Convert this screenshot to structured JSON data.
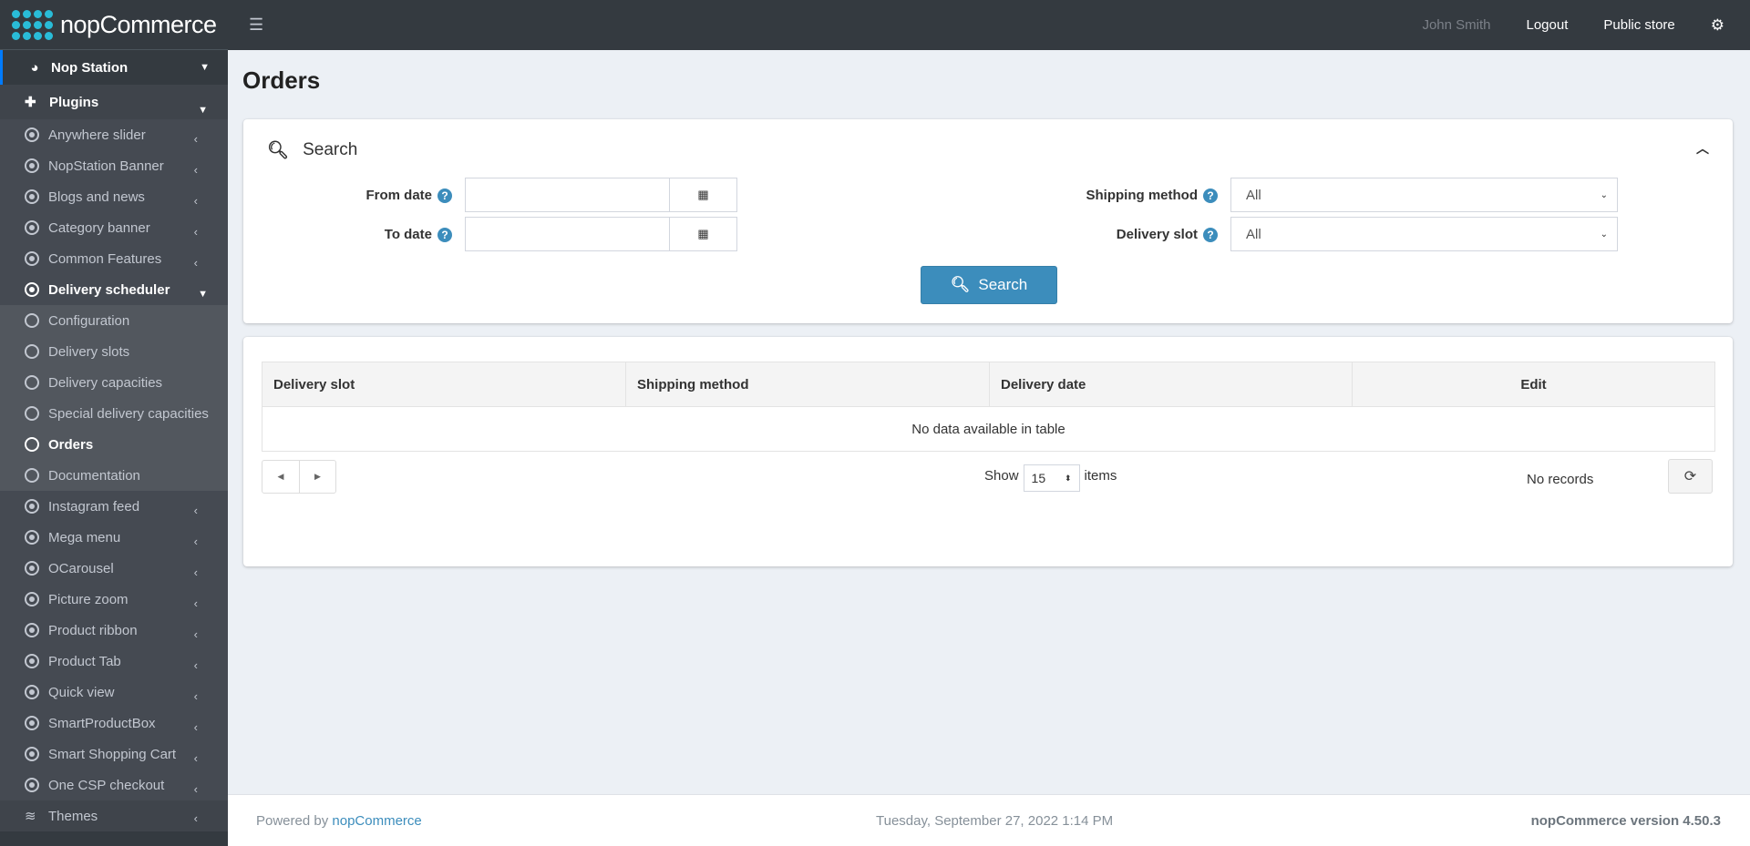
{
  "brand": {
    "name": "nopCommerce"
  },
  "topbar": {
    "user": "John Smith",
    "logout": "Logout",
    "public_store": "Public store"
  },
  "sidebar": {
    "nop_station": "Nop Station",
    "plugins": "Plugins",
    "items_before": [
      "Anywhere slider",
      "NopStation Banner",
      "Blogs and news",
      "Category banner",
      "Common Features"
    ],
    "active_parent": "Delivery scheduler",
    "sub_items": [
      "Configuration",
      "Delivery slots",
      "Delivery capacities",
      "Special delivery capacities",
      "Orders",
      "Documentation"
    ],
    "active_sub": "Orders",
    "items_after": [
      "Instagram feed",
      "Mega menu",
      "OCarousel",
      "Picture zoom",
      "Product ribbon",
      "Product Tab",
      "Quick view",
      "SmartProductBox",
      "Smart Shopping Cart",
      "One CSP checkout"
    ],
    "themes": "Themes"
  },
  "page": {
    "title": "Orders"
  },
  "search": {
    "heading": "Search",
    "from_date_label": "From date",
    "from_date_value": "",
    "to_date_label": "To date",
    "to_date_value": "",
    "shipping_method_label": "Shipping method",
    "shipping_method_value": "All",
    "delivery_slot_label": "Delivery slot",
    "delivery_slot_value": "All",
    "button": "Search"
  },
  "table": {
    "columns": [
      "Delivery slot",
      "Shipping method",
      "Delivery date",
      "Edit"
    ],
    "empty_message": "No data available in table",
    "show_label": "Show",
    "page_size": "15",
    "items_label": "items",
    "records": "No records"
  },
  "footer": {
    "powered_by": "Powered by",
    "powered_link": "nopCommerce",
    "datetime": "Tuesday, September 27, 2022 1:14 PM",
    "version": "nopCommerce version 4.50.3"
  },
  "colors": {
    "accent": "#3c8dbc",
    "navbar": "#343a40",
    "logo": "#29bcd8",
    "active_border": "#007bff"
  }
}
